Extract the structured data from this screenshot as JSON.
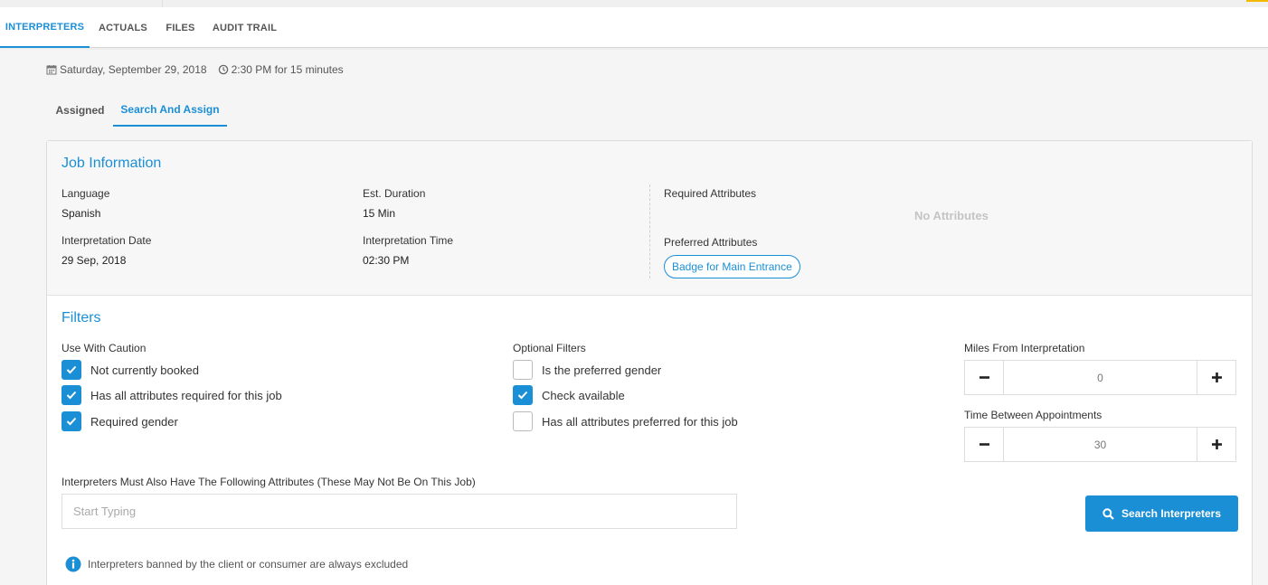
{
  "tabs": [
    {
      "label": "INTERPRETERS",
      "active": true
    },
    {
      "label": "ACTUALS",
      "active": false
    },
    {
      "label": "FILES",
      "active": false
    },
    {
      "label": "AUDIT TRAIL",
      "active": false
    }
  ],
  "header": {
    "date": "Saturday, September 29, 2018",
    "time": "2:30 PM for 15 minutes"
  },
  "subtabs": [
    {
      "label": "Assigned",
      "active": false
    },
    {
      "label": "Search And Assign",
      "active": true
    }
  ],
  "job_info": {
    "title": "Job Information",
    "language_label": "Language",
    "language": "Spanish",
    "duration_label": "Est. Duration",
    "duration": "15 Min",
    "date_label": "Interpretation Date",
    "date": "29 Sep, 2018",
    "time_label": "Interpretation Time",
    "time": "02:30 PM",
    "required_label": "Required Attributes",
    "required_empty": "No Attributes",
    "preferred_label": "Preferred Attributes",
    "preferred": [
      "Badge for Main Entrance"
    ]
  },
  "filters": {
    "title": "Filters",
    "caution_label": "Use With Caution",
    "caution": [
      {
        "label": "Not currently booked",
        "checked": true
      },
      {
        "label": "Has all attributes required for this job",
        "checked": true
      },
      {
        "label": "Required gender",
        "checked": true
      }
    ],
    "optional_label": "Optional Filters",
    "optional": [
      {
        "label": "Is the preferred gender",
        "checked": false
      },
      {
        "label": "Check available",
        "checked": true
      },
      {
        "label": "Has all attributes preferred for this job",
        "checked": false
      }
    ],
    "miles_label": "Miles From Interpretation",
    "miles": "0",
    "time_between_label": "Time Between Appointments",
    "time_between": "30",
    "attributes_label": "Interpreters Must Also Have The Following Attributes (These May Not Be On This Job)",
    "attributes_placeholder": "Start Typing",
    "search_label": "Search Interpreters",
    "note": "Interpreters banned by the client or consumer are always excluded"
  },
  "colors": {
    "accent": "#1a8fd6",
    "top_accent": "#f5b800"
  },
  "icons": {
    "date": "calendar-icon",
    "time": "clock-icon",
    "checkbox": "check-icon",
    "minus": "minus-icon",
    "plus": "plus-icon",
    "search": "search-icon",
    "info": "info-icon"
  }
}
